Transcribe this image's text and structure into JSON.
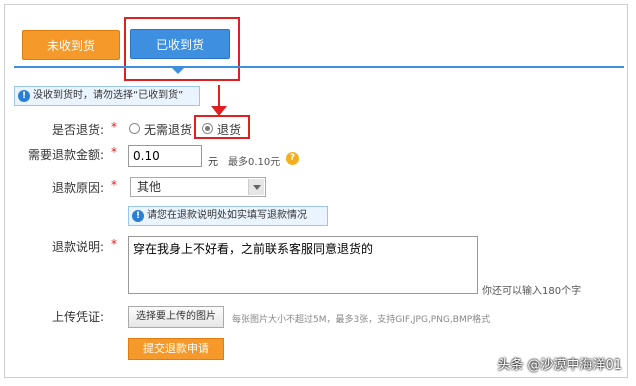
{
  "tabs": {
    "unreceived": "未收到货",
    "received": "已收到货"
  },
  "notice": "没收到货时，请勿选择“已收到货”",
  "form": {
    "return_label": "是否退货:",
    "return_options": [
      "无需退货",
      "退货"
    ],
    "return_selected": "退货",
    "amount_label": "需要退款金额:",
    "amount_value": "0.10",
    "amount_unit": "元",
    "amount_max": "最多0.10元",
    "reason_label": "退款原因:",
    "reason_value": "其他",
    "reason_tip": "请您在退款说明处如实填写退款情况",
    "desc_label": "退款说明:",
    "desc_value": "穿在我身上不好看，之前联系客服同意退货的",
    "desc_remaining": "你还可以输入180个字",
    "upload_label": "上传凭证:",
    "upload_button": "选择要上传的图片",
    "upload_hint": "每张图片大小不超过5M，最多3张，支持GIF,JPG,PNG,BMP格式",
    "submit_button": "提交退款申请"
  },
  "required_mark": "*",
  "watermark": "头条 @沙漠中海洋01",
  "colors": {
    "orange": "#f59a2a",
    "blue": "#3e8fe0",
    "highlight_red": "#e02020"
  }
}
